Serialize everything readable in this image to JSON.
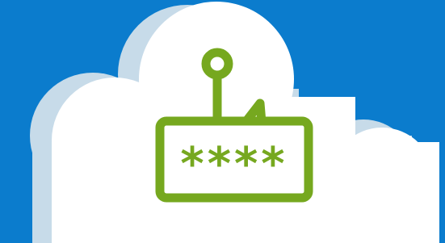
{
  "scene": {
    "background_color": "#0b7ccd",
    "cloud_color": "#ffffff",
    "cloud_shadow_color": "#c7dbe9",
    "accent_color": "#76a81f",
    "icons": [
      "cloud-icon",
      "fishing-hook-icon",
      "password-field-icon"
    ],
    "password_mask": "****"
  }
}
